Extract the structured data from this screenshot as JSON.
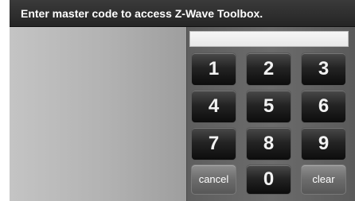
{
  "header": {
    "prompt": "Enter master code to access Z-Wave Toolbox."
  },
  "code_field": {
    "value": ""
  },
  "keypad": {
    "k1": "1",
    "k2": "2",
    "k3": "3",
    "k4": "4",
    "k5": "5",
    "k6": "6",
    "k7": "7",
    "k8": "8",
    "k9": "9",
    "k0": "0",
    "cancel": "cancel",
    "clear": "clear"
  }
}
